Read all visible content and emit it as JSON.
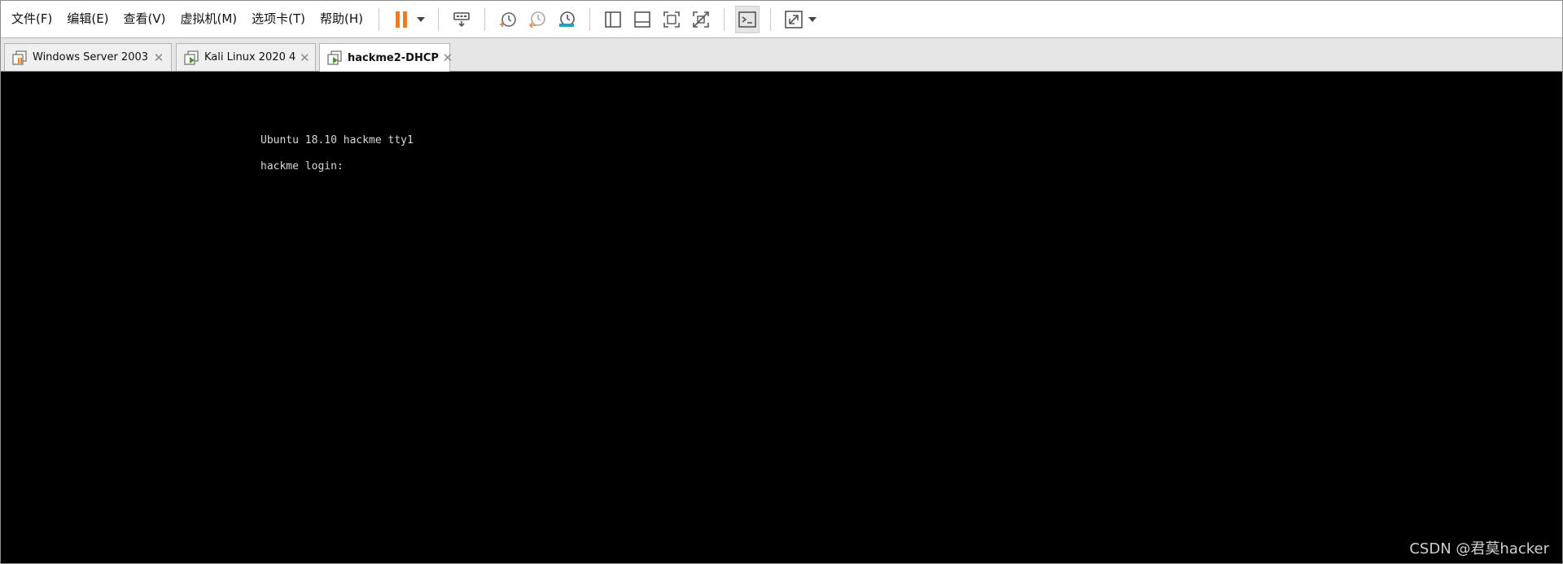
{
  "menu": {
    "items": [
      {
        "label": "文件(F)"
      },
      {
        "label": "编辑(E)"
      },
      {
        "label": "查看(V)"
      },
      {
        "label": "虚拟机(M)"
      },
      {
        "label": "选项卡(T)"
      },
      {
        "label": "帮助(H)"
      }
    ]
  },
  "toolbar": {
    "icons": [
      "pause-icon",
      "send-ctrl-alt-del-icon",
      "snapshot-take-icon",
      "snapshot-revert-icon",
      "snapshot-manager-icon",
      "show-library-icon",
      "show-thumbnail-bar-icon",
      "full-screen-icon",
      "unity-icon",
      "console-view-icon",
      "stretch-guest-icon"
    ],
    "pause_color": "#f07a1f"
  },
  "tabs": [
    {
      "label": "Windows Server 2003",
      "state": "suspended",
      "active": false
    },
    {
      "label": "Kali Linux 2020 4",
      "state": "running",
      "active": false
    },
    {
      "label": "hackme2-DHCP",
      "state": "running",
      "active": true
    }
  ],
  "console": {
    "lines": [
      "Ubuntu 18.10 hackme tty1",
      "hackme login:"
    ]
  },
  "watermark": "CSDN @君莫hacker"
}
